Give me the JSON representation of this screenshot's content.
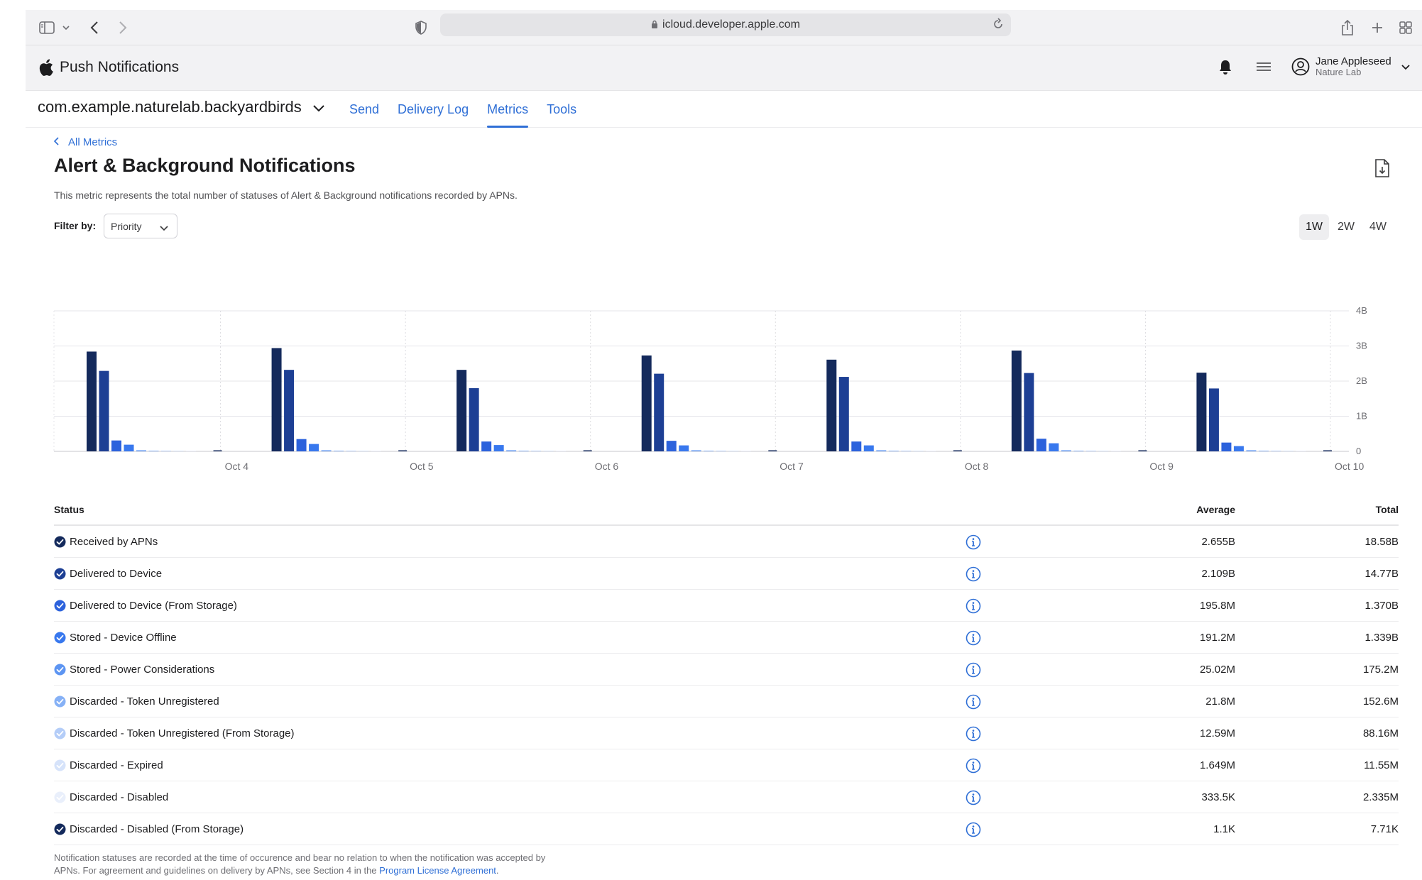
{
  "browser": {
    "url": "icloud.developer.apple.com"
  },
  "app": {
    "title": "Push Notifications",
    "user_name": "Jane Appleseed",
    "user_team": "Nature Lab"
  },
  "nav": {
    "bundle_id": "com.example.naturelab.backyardbirds",
    "tabs": [
      {
        "label": "Send",
        "active": false
      },
      {
        "label": "Delivery Log",
        "active": false
      },
      {
        "label": "Metrics",
        "active": true
      },
      {
        "label": "Tools",
        "active": false
      }
    ]
  },
  "page": {
    "back_label": "All Metrics",
    "title": "Alert & Background Notifications",
    "description": "This metric represents the total number of statuses of Alert & Background notifications recorded by APNs.",
    "filter_label": "Filter by:",
    "filter_value": "Priority",
    "ranges": [
      {
        "label": "1W",
        "active": true
      },
      {
        "label": "2W",
        "active": false
      },
      {
        "label": "4W",
        "active": false
      }
    ]
  },
  "chart_data": {
    "type": "bar",
    "categories": [
      "Oct 4",
      "Oct 5",
      "Oct 6",
      "Oct 7",
      "Oct 8",
      "Oct 9",
      "Oct 10"
    ],
    "y_ticks": [
      "0",
      "1B",
      "2B",
      "3B",
      "4B"
    ],
    "ylim": [
      0,
      4
    ],
    "y_unit": "B",
    "series": [
      {
        "name": "Received by APNs",
        "color": "#142a5c",
        "values": [
          2.84,
          2.94,
          2.32,
          2.73,
          2.61,
          2.87,
          2.24
        ]
      },
      {
        "name": "Delivered to Device",
        "color": "#1d3f94",
        "values": [
          2.29,
          2.32,
          1.8,
          2.21,
          2.12,
          2.23,
          1.79
        ]
      },
      {
        "name": "Delivered to Device (From Storage)",
        "color": "#2c62dc",
        "values": [
          0.31,
          0.35,
          0.28,
          0.3,
          0.28,
          0.36,
          0.25
        ]
      },
      {
        "name": "Stored - Device Offline",
        "color": "#3878ee",
        "values": [
          0.19,
          0.21,
          0.18,
          0.17,
          0.17,
          0.23,
          0.15
        ]
      },
      {
        "name": "Stored - Power Considerations",
        "color": "#5d95f2",
        "values": [
          0.03,
          0.03,
          0.03,
          0.03,
          0.03,
          0.03,
          0.03
        ]
      },
      {
        "name": "Discarded - Token Unregistered",
        "color": "#86b1f6",
        "values": [
          0.02,
          0.02,
          0.02,
          0.02,
          0.02,
          0.02,
          0.02
        ]
      },
      {
        "name": "Discarded - Token Unregistered (From Storage)",
        "color": "#b4cdf8",
        "values": [
          0.01,
          0.01,
          0.01,
          0.01,
          0.01,
          0.01,
          0.01
        ]
      },
      {
        "name": "Discarded - Expired",
        "color": "#d6e3fa",
        "values": [
          0.002,
          0.002,
          0.002,
          0.002,
          0.002,
          0.002,
          0.002
        ]
      },
      {
        "name": "Discarded - Disabled",
        "color": "#e9effb",
        "values": [
          0.0004,
          0.0004,
          0.0004,
          0.0004,
          0.0004,
          0.0004,
          0.0004
        ]
      },
      {
        "name": "Discarded - Disabled (From Storage)",
        "color": "#142a5c",
        "values": [
          0.0,
          0.0,
          0.0,
          0.0,
          0.0,
          0.0,
          0.0
        ]
      }
    ]
  },
  "table": {
    "headers": {
      "status": "Status",
      "average": "Average",
      "total": "Total"
    },
    "rows": [
      {
        "status": "Received by APNs",
        "average": "2.655B",
        "total": "18.58B",
        "color": "#142a5c"
      },
      {
        "status": "Delivered to Device",
        "average": "2.109B",
        "total": "14.77B",
        "color": "#1d3f94"
      },
      {
        "status": "Delivered to Device (From Storage)",
        "average": "195.8M",
        "total": "1.370B",
        "color": "#2c62dc"
      },
      {
        "status": "Stored - Device Offline",
        "average": "191.2M",
        "total": "1.339B",
        "color": "#3878ee"
      },
      {
        "status": "Stored - Power Considerations",
        "average": "25.02M",
        "total": "175.2M",
        "color": "#5d95f2"
      },
      {
        "status": "Discarded - Token Unregistered",
        "average": "21.8M",
        "total": "152.6M",
        "color": "#86b1f6"
      },
      {
        "status": "Discarded - Token Unregistered (From Storage)",
        "average": "12.59M",
        "total": "88.16M",
        "color": "#b4cdf8"
      },
      {
        "status": "Discarded - Expired",
        "average": "1.649M",
        "total": "11.55M",
        "color": "#d6e3fa"
      },
      {
        "status": "Discarded - Disabled",
        "average": "333.5K",
        "total": "2.335M",
        "color": "#e9effb"
      },
      {
        "status": "Discarded - Disabled (From Storage)",
        "average": "1.1K",
        "total": "7.71K",
        "color": "#142a5c"
      }
    ]
  },
  "footnote": {
    "text_1": "Notification statuses are recorded at the time of occurence and bear no relation to when the notification was accepted by",
    "text_2": "APNs. For agreement and guidelines on delivery by APNs, see Section 4 in the ",
    "link": "Program License Agreement",
    "text_3": "."
  }
}
